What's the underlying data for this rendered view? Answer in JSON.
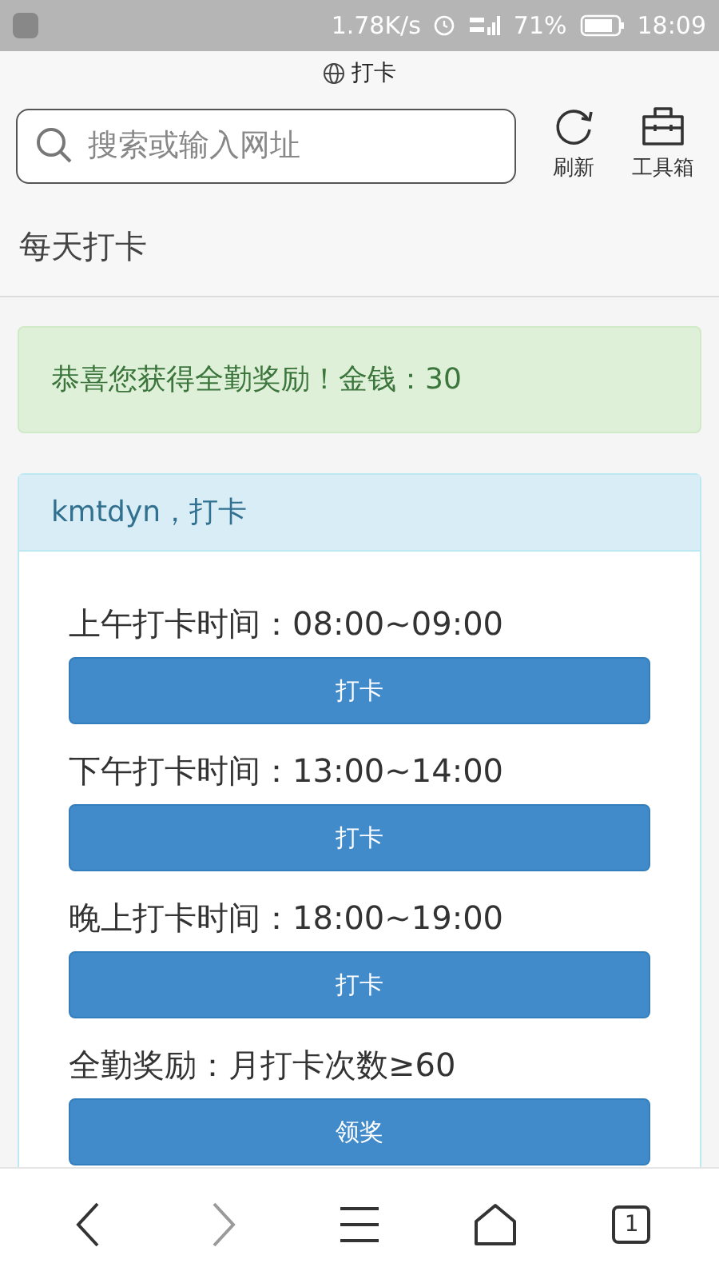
{
  "status_bar": {
    "speed": "1.78K/s",
    "battery": "71%",
    "time": "18:09"
  },
  "page_title": "打卡",
  "toolbar": {
    "search": {
      "placeholder": "搜索或输入网址"
    },
    "actions": [
      {
        "kind": "refresh",
        "label": "刷新"
      },
      {
        "kind": "toolbox",
        "label": "工具箱"
      }
    ]
  },
  "heading": "每天打卡",
  "alert": "恭喜您获得全勤奖励！金钱：30",
  "panel": {
    "title": "kmtdyn，打卡",
    "rows": [
      {
        "label": "上午打卡时间：08:00~09:00",
        "button": "打卡"
      },
      {
        "label": "下午打卡时间：13:00~14:00",
        "button": "打卡"
      },
      {
        "label": "晚上打卡时间：18:00~19:00",
        "button": "打卡"
      },
      {
        "label": "全勤奖励：月打卡次数≥60",
        "button": "领奖"
      }
    ]
  },
  "bottom_nav": [
    {
      "kind": "back",
      "disabled": false
    },
    {
      "kind": "forward",
      "disabled": true
    },
    {
      "kind": "menu",
      "disabled": false
    },
    {
      "kind": "home",
      "disabled": false
    },
    {
      "kind": "tabs",
      "count": "1",
      "disabled": false
    }
  ]
}
